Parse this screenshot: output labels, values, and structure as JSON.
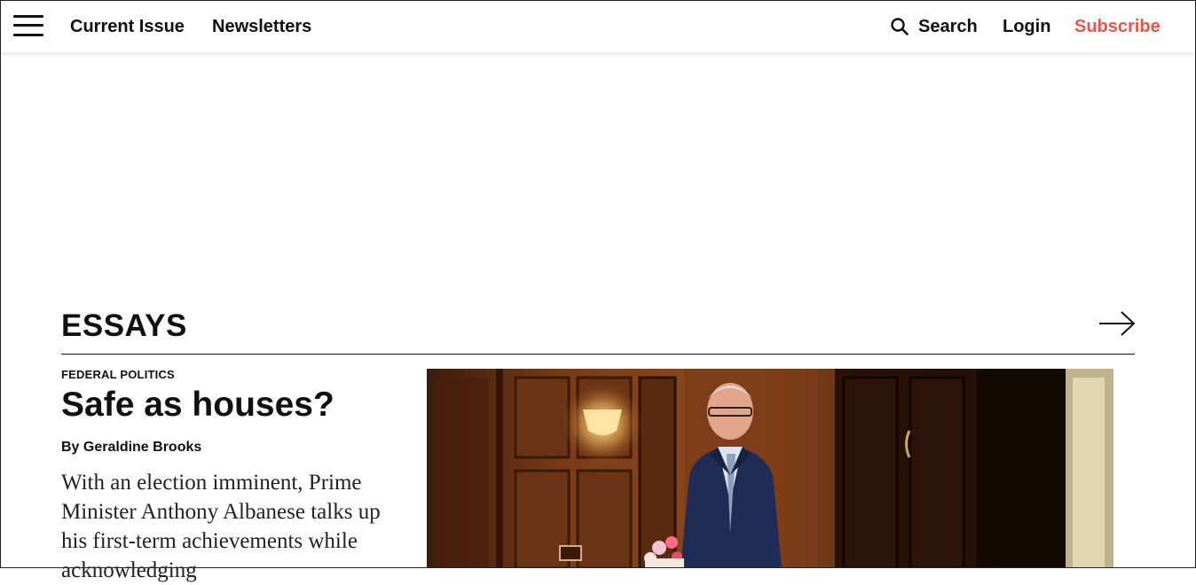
{
  "header": {
    "nav": {
      "current_issue": "Current Issue",
      "newsletters": "Newsletters",
      "search": "Search",
      "login": "Login",
      "subscribe": "Subscribe"
    },
    "accent_color": "#e4574a"
  },
  "section": {
    "title": "ESSAYS"
  },
  "article": {
    "kicker": "FEDERAL POLITICS",
    "headline": "Safe as houses?",
    "byline": "By Geraldine Brooks",
    "standfirst": "With an election imminent, Prime Minister Anthony Albanese talks up his first-term achievements while acknowledging"
  }
}
